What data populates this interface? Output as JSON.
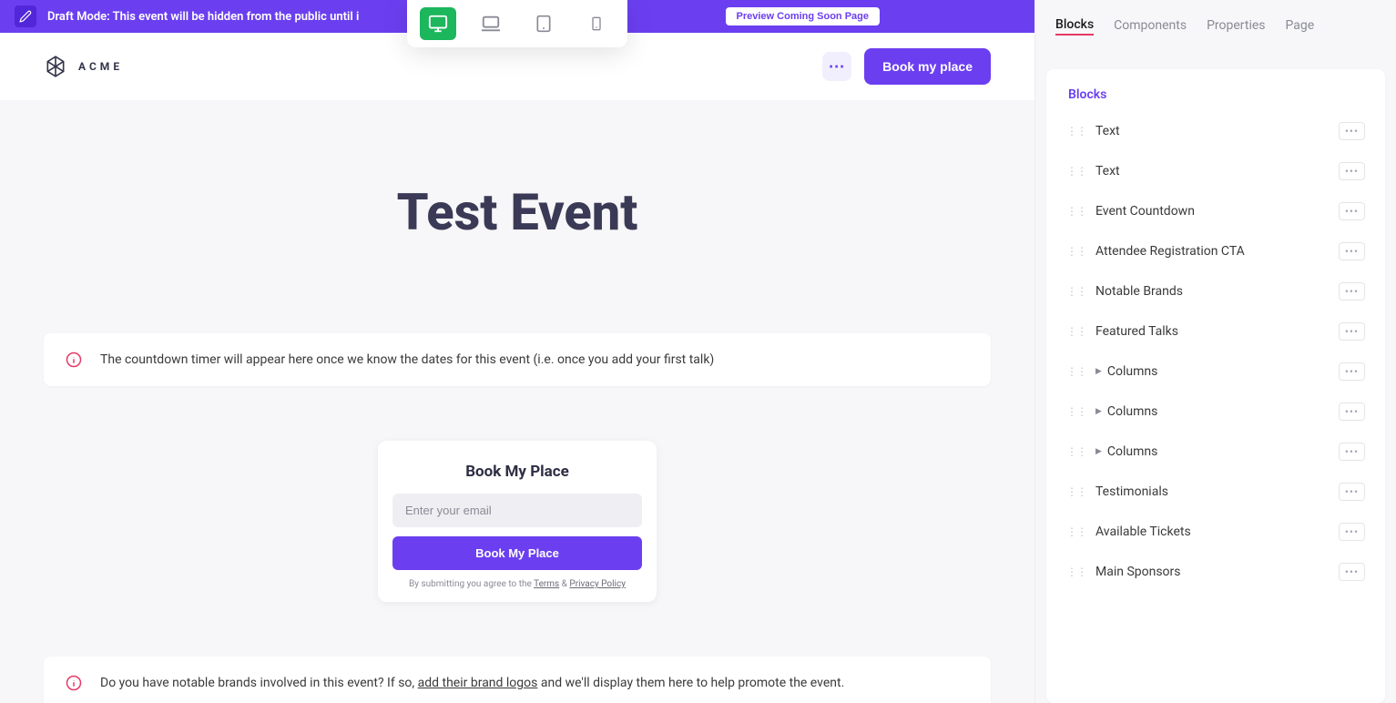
{
  "banner": {
    "text": "Draft Mode: This event will be hidden from the public until i",
    "preview_btn": "Preview Coming Soon Page"
  },
  "header": {
    "logo_text": "ACME",
    "book_btn": "Book my place"
  },
  "content": {
    "event_title": "Test Event",
    "countdown_info": "The countdown timer will appear here once we know the dates for this event (i.e. once you add your first talk)",
    "brands_info_pre": "Do you have notable brands involved in this event? If so, ",
    "brands_info_link": "add their brand logos",
    "brands_info_post": " and we'll display them here to help promote the event."
  },
  "booking": {
    "title": "Book My Place",
    "placeholder": "Enter your email",
    "submit": "Book My Place",
    "legal_pre": "By submitting you agree to the ",
    "terms": "Terms",
    "amp": " & ",
    "privacy": "Privacy Policy"
  },
  "sidebar": {
    "tabs": [
      "Blocks",
      "Components",
      "Properties",
      "Page"
    ],
    "active_tab": 0,
    "panel_title": "Blocks",
    "blocks": [
      {
        "label": "Text",
        "expandable": false
      },
      {
        "label": "Text",
        "expandable": false
      },
      {
        "label": "Event Countdown",
        "expandable": false
      },
      {
        "label": "Attendee Registration CTA",
        "expandable": false
      },
      {
        "label": "Notable Brands",
        "expandable": false
      },
      {
        "label": "Featured Talks",
        "expandable": false
      },
      {
        "label": "Columns",
        "expandable": true
      },
      {
        "label": "Columns",
        "expandable": true
      },
      {
        "label": "Columns",
        "expandable": true
      },
      {
        "label": "Testimonials",
        "expandable": false
      },
      {
        "label": "Available Tickets",
        "expandable": false
      },
      {
        "label": "Main Sponsors",
        "expandable": false
      }
    ]
  }
}
